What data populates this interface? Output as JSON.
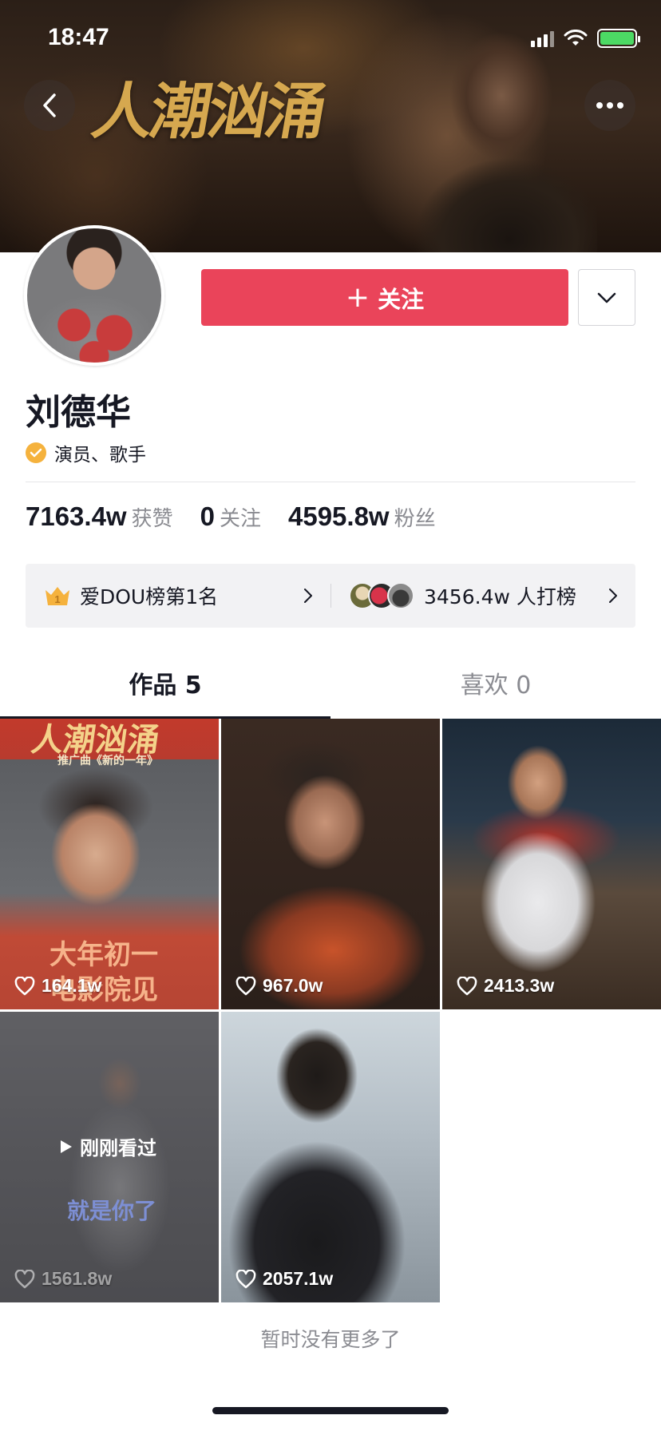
{
  "status_bar": {
    "time": "18:47"
  },
  "cover": {
    "title": "人潮汹涌"
  },
  "profile": {
    "name": "刘德华",
    "verification": "演员、歌手",
    "follow_button": "关注",
    "follow_plus": "+"
  },
  "stats": [
    {
      "value": "7163.4w",
      "label": "获赞"
    },
    {
      "value": "0",
      "label": "关注"
    },
    {
      "value": "4595.8w",
      "label": "粉丝"
    }
  ],
  "rank": {
    "left_text": "爱DOU榜第1名",
    "right_text": "3456.4w 人打榜"
  },
  "tabs": [
    {
      "label": "作品 5",
      "active": true
    },
    {
      "label": "喜欢 0",
      "active": false
    }
  ],
  "videos": [
    {
      "likes": "164.1w",
      "caption_top": "人潮汹涌",
      "caption_sub": "推广曲《新的一年》",
      "caption_bottom_1": "大年初一",
      "caption_bottom_2": "电影院见"
    },
    {
      "likes": "967.0w"
    },
    {
      "likes": "2413.3w"
    },
    {
      "likes": "1561.8w",
      "recent_label": "刚刚看过",
      "caption": "就是你了"
    },
    {
      "likes": "2057.1w"
    }
  ],
  "footer": {
    "text": "暂时没有更多了"
  },
  "colors": {
    "accent": "#ea445a",
    "verify": "#f5b23d",
    "text": "#161823",
    "muted": "#8a8b91"
  }
}
